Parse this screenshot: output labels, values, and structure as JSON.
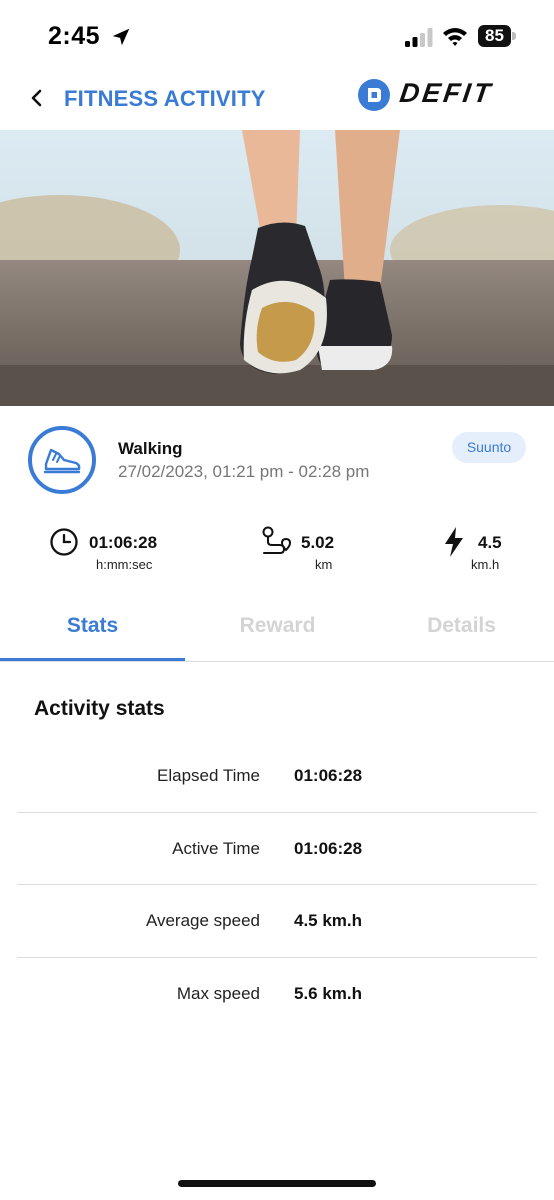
{
  "status_bar": {
    "time": "2:45",
    "battery": "85",
    "icons": [
      "location-arrow-icon",
      "cellular-signal-icon",
      "wifi-icon",
      "battery-icon"
    ]
  },
  "header": {
    "back_icon": "chevron-left-icon",
    "title": "FITNESS ACTIVITY",
    "brand_icon": "defit-logo-icon",
    "brand_name": "DEFIT"
  },
  "hero": {
    "image": "walking-shoes-photo"
  },
  "activity": {
    "icon": "sneaker-icon",
    "type": "Walking",
    "datetime": "27/02/2023, 01:21 pm - 02:28 pm",
    "source": "Suunto"
  },
  "metrics": [
    {
      "icon": "clock-icon",
      "value": "01:06:28",
      "unit": "h:mm:sec"
    },
    {
      "icon": "route-icon",
      "value": "5.02",
      "unit": "km"
    },
    {
      "icon": "lightning-icon",
      "value": "4.5",
      "unit": "km.h"
    }
  ],
  "tabs": [
    {
      "label": "Stats",
      "active": true
    },
    {
      "label": "Reward",
      "active": false
    },
    {
      "label": "Details",
      "active": false
    }
  ],
  "stats": {
    "title": "Activity stats",
    "rows": [
      {
        "label": "Elapsed Time",
        "value": "01:06:28"
      },
      {
        "label": "Active Time",
        "value": "01:06:28"
      },
      {
        "label": "Average speed",
        "value": "4.5 km.h"
      },
      {
        "label": "Max speed",
        "value": "5.6 km.h"
      }
    ]
  },
  "colors": {
    "accent": "#3a7bd5",
    "badge_bg": "#e5eefb",
    "inactive_tab": "#d4d4d4",
    "divider": "#dddddd"
  }
}
